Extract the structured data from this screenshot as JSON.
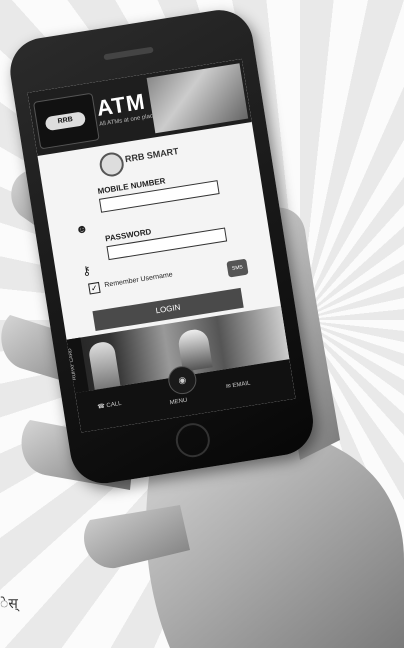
{
  "app": {
    "title": "ATM",
    "subtitle": "All ATMs at one place",
    "logo_text": "RRB",
    "brand_name": "RRB SMART"
  },
  "form": {
    "mobile_label": "MOBILE NUMBER",
    "mobile_value": "",
    "password_label": "PASSWORD",
    "password_value": "",
    "remember_label": "Remember Username",
    "remember_checked": true,
    "sms_label": "SMS",
    "login_label": "LOGIN"
  },
  "promo": {
    "side_text": "RUPAY CARD"
  },
  "bottom_nav": {
    "call_label": "CALL",
    "menu_label": "MENU",
    "email_label": "EMAIL"
  },
  "background": {
    "corner_text": "ेस्"
  },
  "icons": {
    "user": "user-icon",
    "key": "key-icon",
    "phone": "phone-icon",
    "mail": "mail-icon",
    "menu": "menu-icon"
  }
}
